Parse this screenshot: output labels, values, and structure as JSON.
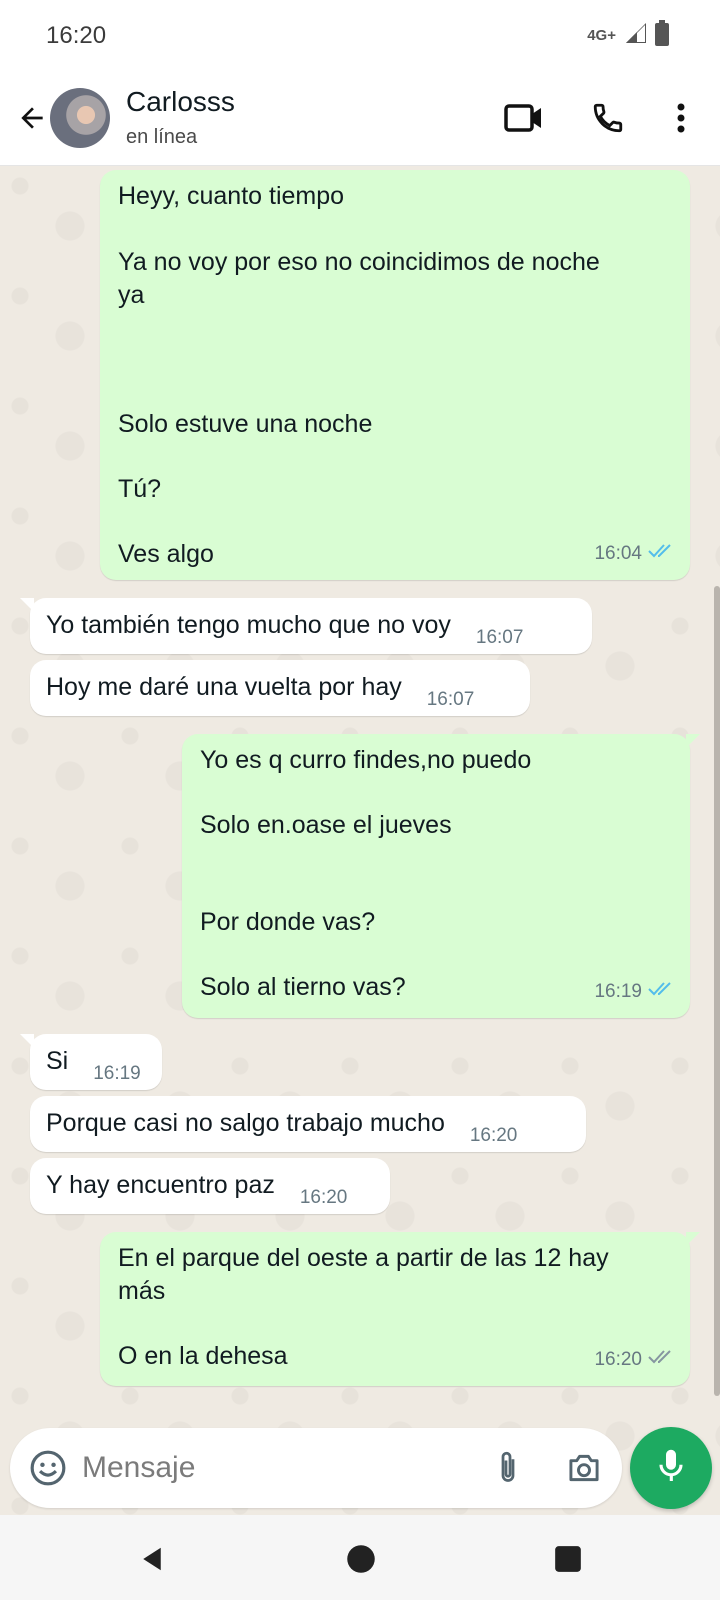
{
  "status_bar": {
    "time": "16:20",
    "network": "4G+"
  },
  "header": {
    "contact_name": "Carlosss",
    "contact_status": "en línea",
    "icons": [
      "back-arrow-icon",
      "video-call-icon",
      "phone-icon",
      "more-vert-icon"
    ]
  },
  "messages": [
    {
      "direction": "outgoing",
      "lines": [
        "Heyy, cuanto tiempo",
        "",
        "Ya no voy por eso no coincidimos de noche",
        "ya",
        "",
        "",
        "",
        "Solo estuve una noche",
        "",
        "Tú?",
        "",
        "Ves algo"
      ],
      "time": "16:04",
      "status": "read"
    },
    {
      "direction": "incoming",
      "text": "Yo también tengo mucho que no voy",
      "time": "16:07"
    },
    {
      "direction": "incoming",
      "text": "Hoy me daré una vuelta por hay",
      "time": "16:07"
    },
    {
      "direction": "outgoing",
      "lines": [
        "Yo es q curro findes,no puedo",
        "",
        "Solo en.oase el jueves",
        "",
        "",
        "Por donde vas?",
        "",
        "Solo al tierno vas?"
      ],
      "time": "16:19",
      "status": "read"
    },
    {
      "direction": "incoming",
      "text": "Si",
      "time": "16:19"
    },
    {
      "direction": "incoming",
      "text": "Porque casi no salgo trabajo mucho",
      "time": "16:20"
    },
    {
      "direction": "incoming",
      "text": "Y hay encuentro paz",
      "time": "16:20"
    },
    {
      "direction": "outgoing",
      "lines": [
        "En el parque del oeste a partir de las 12 hay",
        "más",
        "",
        "O en la dehesa"
      ],
      "time": "16:20",
      "status": "delivered"
    }
  ],
  "composer": {
    "placeholder": "Mensaje",
    "icons": [
      "emoji-icon",
      "attach-icon",
      "camera-icon",
      "mic-icon"
    ]
  },
  "colors": {
    "outgoing_bubble": "#d9fdd3",
    "incoming_bubble": "#ffffff",
    "chat_background": "#efeae2",
    "read_ticks": "#53bdeb",
    "delivered_ticks": "#8696a0",
    "mic_button": "#1daa61"
  }
}
